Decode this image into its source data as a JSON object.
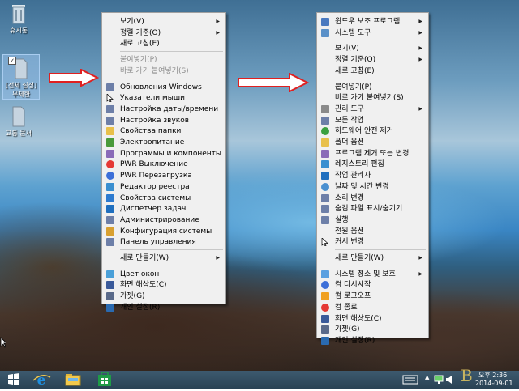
{
  "desktop": {
    "recycle_bin_label": "휴지통",
    "selected_icon_label": "[전체 설정] 무제한",
    "third_icon_label": "교통 문서"
  },
  "menu_left": {
    "items": [
      {
        "label": "보기(V)",
        "submenu": true,
        "disabled": false,
        "icon": "none"
      },
      {
        "label": "정렬 기준(O)",
        "submenu": true,
        "disabled": false,
        "icon": "none"
      },
      {
        "label": "새로 고침(E)",
        "submenu": false,
        "disabled": false,
        "icon": "none"
      },
      {
        "label": "붙여넣기(P)",
        "submenu": false,
        "disabled": true,
        "icon": "none"
      },
      {
        "label": "바로 가기 붙여넣기(S)",
        "submenu": false,
        "disabled": true,
        "icon": "none"
      },
      {
        "label": "Обновления Windows",
        "submenu": false,
        "disabled": false,
        "icon": "page-icon"
      },
      {
        "label": "Указатели мыши",
        "submenu": false,
        "disabled": false,
        "icon": "cursor-icon"
      },
      {
        "label": "Настройка даты/времени",
        "submenu": false,
        "disabled": false,
        "icon": "page-icon"
      },
      {
        "label": "Настройка звуков",
        "submenu": false,
        "disabled": false,
        "icon": "page-icon"
      },
      {
        "label": "Свойства папки",
        "submenu": false,
        "disabled": false,
        "icon": "folder-icon"
      },
      {
        "label": "Электропитание",
        "submenu": false,
        "disabled": false,
        "icon": "power-options-icon"
      },
      {
        "label": "Программы и компоненты",
        "submenu": false,
        "disabled": false,
        "icon": "programs-icon"
      },
      {
        "label": "PWR Выключение",
        "submenu": false,
        "disabled": false,
        "icon": "shutdown-icon"
      },
      {
        "label": "PWR Перезагрузка",
        "submenu": false,
        "disabled": false,
        "icon": "restart-icon"
      },
      {
        "label": "Редактор реестра",
        "submenu": false,
        "disabled": false,
        "icon": "registry-icon"
      },
      {
        "label": "Свойства системы",
        "submenu": false,
        "disabled": false,
        "icon": "system-icon"
      },
      {
        "label": "Диспетчер задач",
        "submenu": false,
        "disabled": false,
        "icon": "task-manager-icon"
      },
      {
        "label": "Администрирование",
        "submenu": false,
        "disabled": false,
        "icon": "page-icon"
      },
      {
        "label": "Конфигурация системы",
        "submenu": false,
        "disabled": false,
        "icon": "msconfig-icon"
      },
      {
        "label": "Панель управления",
        "submenu": false,
        "disabled": false,
        "icon": "page-icon"
      },
      {
        "label": "새로 만들기(W)",
        "submenu": true,
        "disabled": false,
        "icon": "none"
      },
      {
        "label": "Цвет окон",
        "submenu": false,
        "disabled": false,
        "icon": "window-color-icon"
      },
      {
        "label": "화면 해상도(C)",
        "submenu": false,
        "disabled": false,
        "icon": "display-icon"
      },
      {
        "label": "가젯(G)",
        "submenu": false,
        "disabled": false,
        "icon": "gadget-icon"
      },
      {
        "label": "개인 설정(R)",
        "submenu": false,
        "disabled": false,
        "icon": "personalize-icon"
      }
    ]
  },
  "menu_right": {
    "items": [
      {
        "label": "윈도우 보조 프로그램",
        "submenu": true,
        "disabled": false,
        "icon": "accessories-icon"
      },
      {
        "label": "시스템 도구",
        "submenu": true,
        "disabled": false,
        "icon": "system-tools-icon"
      },
      {
        "label": "보기(V)",
        "submenu": true,
        "disabled": false,
        "icon": "none"
      },
      {
        "label": "정렬 기준(O)",
        "submenu": true,
        "disabled": false,
        "icon": "none"
      },
      {
        "label": "새로 고침(E)",
        "submenu": false,
        "disabled": false,
        "icon": "none"
      },
      {
        "label": "붙여넣기(P)",
        "submenu": false,
        "disabled": false,
        "icon": "none"
      },
      {
        "label": "바로 가기 붙여넣기(S)",
        "submenu": false,
        "disabled": false,
        "icon": "none"
      },
      {
        "label": "관리 도구",
        "submenu": true,
        "disabled": false,
        "icon": "admin-tools-icon"
      },
      {
        "label": "모든 작업",
        "submenu": false,
        "disabled": false,
        "icon": "page-icon"
      },
      {
        "label": "하드웨어 안전 제거",
        "submenu": false,
        "disabled": false,
        "icon": "eject-icon"
      },
      {
        "label": "폴더 옵션",
        "submenu": false,
        "disabled": false,
        "icon": "folder-icon"
      },
      {
        "label": "프로그램 제거 또는 변경",
        "submenu": false,
        "disabled": false,
        "icon": "programs-icon"
      },
      {
        "label": "레지스트리 편집",
        "submenu": false,
        "disabled": false,
        "icon": "registry-icon"
      },
      {
        "label": "작업 관리자",
        "submenu": false,
        "disabled": false,
        "icon": "task-manager-icon"
      },
      {
        "label": "날짜 및 시간 변경",
        "submenu": false,
        "disabled": false,
        "icon": "clock-icon"
      },
      {
        "label": "소리 변경",
        "submenu": false,
        "disabled": false,
        "icon": "page-icon"
      },
      {
        "label": "숨김 파일 표시/숨기기",
        "submenu": false,
        "disabled": false,
        "icon": "page-icon"
      },
      {
        "label": "실행",
        "submenu": false,
        "disabled": false,
        "icon": "page-icon"
      },
      {
        "label": "전원 옵션",
        "submenu": false,
        "disabled": false,
        "icon": "none"
      },
      {
        "label": "커서 변경",
        "submenu": false,
        "disabled": false,
        "icon": "cursor-icon"
      },
      {
        "label": "새로 만들기(W)",
        "submenu": true,
        "disabled": false,
        "icon": "none"
      },
      {
        "label": "시스템 정소 및 보호",
        "submenu": true,
        "disabled": false,
        "icon": "shield-icon"
      },
      {
        "label": "컴 다시시작",
        "submenu": false,
        "disabled": false,
        "icon": "restart-icon"
      },
      {
        "label": "컴 로그오프",
        "submenu": false,
        "disabled": false,
        "icon": "logoff-icon"
      },
      {
        "label": "컴 종료",
        "submenu": false,
        "disabled": false,
        "icon": "shutdown-icon"
      },
      {
        "label": "화면 해상도(C)",
        "submenu": false,
        "disabled": false,
        "icon": "display-icon"
      },
      {
        "label": "가젯(G)",
        "submenu": false,
        "disabled": false,
        "icon": "gadget-icon"
      },
      {
        "label": "개인 설정(R)",
        "submenu": false,
        "disabled": false,
        "icon": "personalize-icon"
      }
    ]
  },
  "taskbar": {
    "date": "2014-09-01",
    "time": "오후 2:36",
    "watermark": "B"
  },
  "colors": {
    "menu_bg": "#f0f0f0",
    "arrow": "#e02020",
    "taskbar": "#2f4a5e",
    "ie_blue": "#1e8fe0",
    "explorer_yellow": "#f2c94c",
    "store_green": "#1f9b47"
  }
}
